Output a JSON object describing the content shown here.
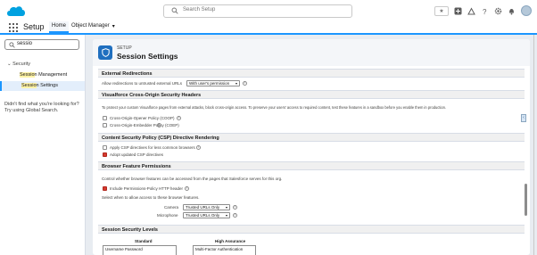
{
  "header": {
    "search_placeholder": "Search Setup",
    "favorites_star": "★"
  },
  "app_bar": {
    "app_name": "Setup",
    "tabs": [
      {
        "label": "Home"
      },
      {
        "label": "Object Manager"
      }
    ]
  },
  "sidebar": {
    "quick_find_value": "sessio",
    "section": "Security",
    "items": [
      {
        "prefix": "Sessio",
        "suffix": "n Management"
      },
      {
        "prefix": "Sessio",
        "suffix": "n Settings"
      }
    ],
    "didnt_find": "Didn't find what you're looking for? Try using Global Search."
  },
  "page": {
    "breadcrumb": "SETUP",
    "title": "Session Settings"
  },
  "sections": {
    "external_redirections": {
      "title": "External Redirections",
      "allow_label": "Allow redirections to untrusted external URLs",
      "allow_value": "With user's permission"
    },
    "visualforce": {
      "title": "Visualforce Cross-Origin Security Headers",
      "description": "To protect your custom Visualforce pages from external attacks, block cross-origin access. To preserve your users' access to required content, test these features in a sandbox before you enable them in production.",
      "coop_label": "Cross-Origin-Opener Policy (COOP)",
      "coep_label": "Cross-Origin-Embedder Policy (COEP)"
    },
    "csp": {
      "title": "Content Security Policy (CSP) Directive Rendering",
      "apply_label": "Apply CSP directives for less common browsers",
      "adopt_label": "Adopt updated CSP directives"
    },
    "browser_features": {
      "title": "Browser Feature Permissions",
      "description": "Control whether browser features can be accessed from the pages that Salesforce serves for this org.",
      "include_label": "Include Permissions-Policy HTTP header",
      "select_label": "Select when to allow access to these browser features.",
      "camera_label": "Camera",
      "camera_value": "Trusted URLs Only",
      "microphone_label": "Microphone",
      "microphone_value": "Trusted URLs Only"
    },
    "security_levels": {
      "title": "Session Security Levels",
      "standard_label": "Standard",
      "high_label": "High Assurance",
      "standard_items": [
        "Username Password"
      ],
      "high_items": [
        "Multi-Factor Authentication"
      ]
    }
  },
  "colors": {
    "accent": "#1b96ff",
    "header_bg": "#ffffff",
    "page_bg": "#e8ecf1",
    "icon_bg": "#1f6fbf"
  }
}
